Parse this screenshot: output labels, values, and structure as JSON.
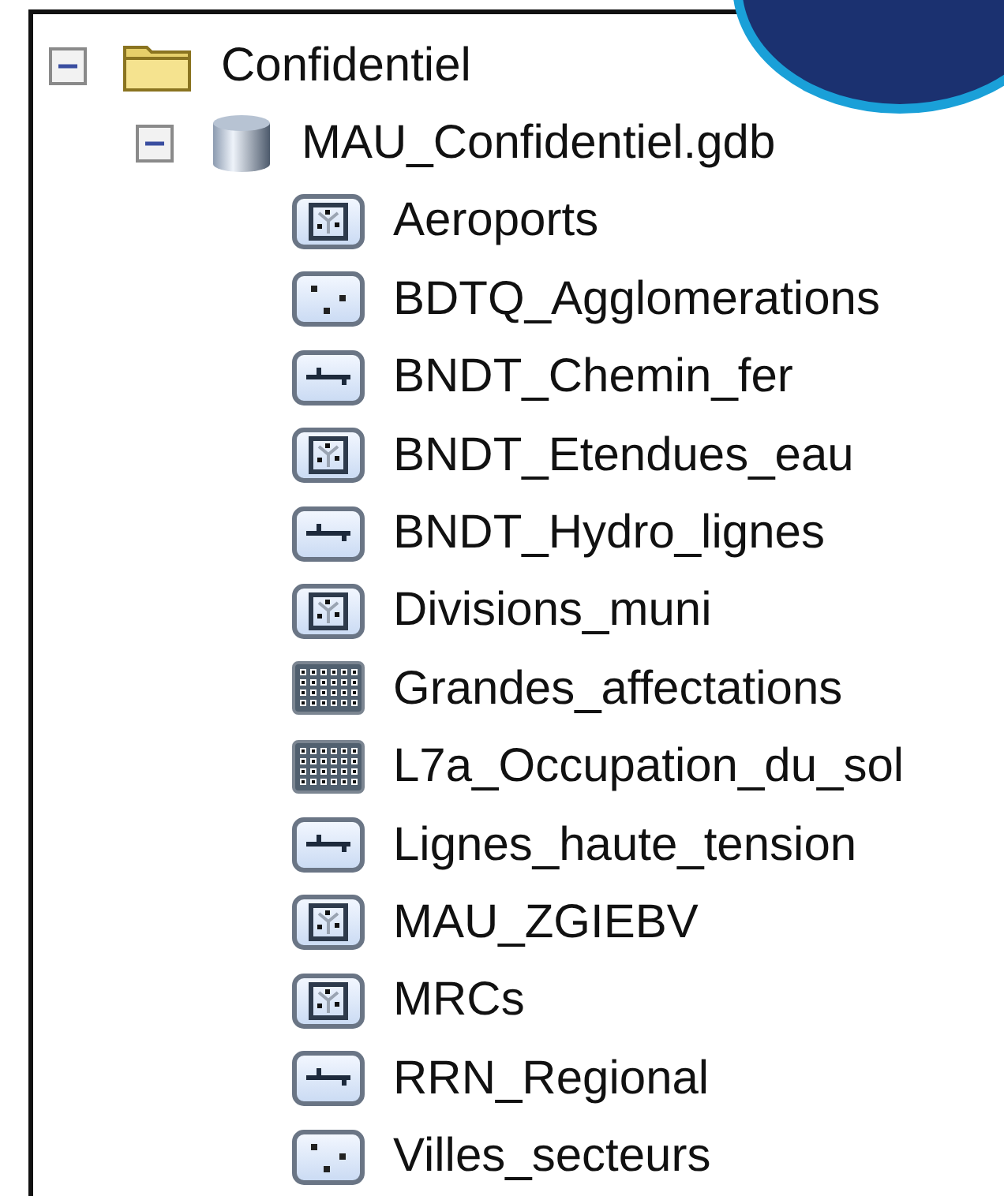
{
  "tree": [
    {
      "label": "Confidentiel",
      "kind": "folder",
      "expanded": true,
      "children": [
        {
          "label": "MAU_Confidentiel.gdb",
          "kind": "database",
          "expanded": true,
          "children": [
            {
              "label": "Aeroports",
              "kind": "polygon"
            },
            {
              "label": "BDTQ_Agglomerations",
              "kind": "point"
            },
            {
              "label": "BNDT_Chemin_fer",
              "kind": "line"
            },
            {
              "label": "BNDT_Etendues_eau",
              "kind": "polygon"
            },
            {
              "label": "BNDT_Hydro_lignes",
              "kind": "line"
            },
            {
              "label": "Divisions_muni",
              "kind": "polygon"
            },
            {
              "label": "Grandes_affectations",
              "kind": "raster"
            },
            {
              "label": "L7a_Occupation_du_sol",
              "kind": "raster"
            },
            {
              "label": "Lignes_haute_tension",
              "kind": "line"
            },
            {
              "label": "MAU_ZGIEBV",
              "kind": "polygon"
            },
            {
              "label": "MRCs",
              "kind": "polygon"
            },
            {
              "label": "RRN_Regional",
              "kind": "line"
            },
            {
              "label": "Villes_secteurs",
              "kind": "point"
            }
          ]
        }
      ]
    }
  ]
}
